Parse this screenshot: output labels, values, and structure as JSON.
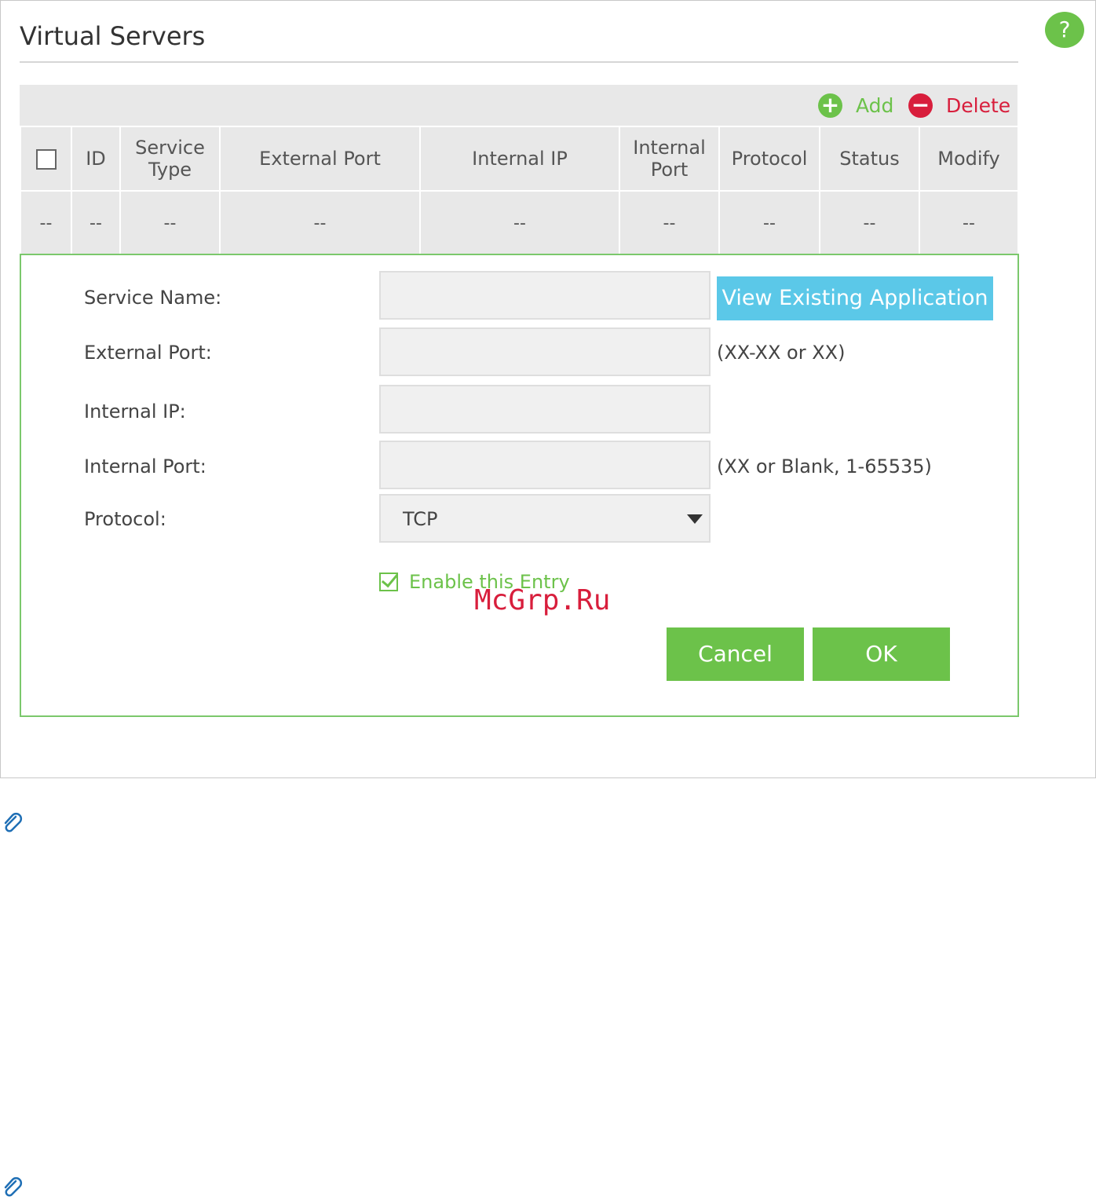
{
  "page": {
    "title": "Virtual Servers",
    "help_label": "?"
  },
  "toolbar": {
    "add_label": "Add",
    "add_icon": "plus-circle-icon",
    "delete_label": "Delete",
    "delete_icon": "minus-circle-icon"
  },
  "table": {
    "headers": [
      "",
      "ID",
      "Service Type",
      "External Port",
      "Internal IP",
      "Internal Port",
      "Protocol",
      "Status",
      "Modify"
    ],
    "rows": [
      [
        "--",
        "--",
        "--",
        "--",
        "--",
        "--",
        "--",
        "--",
        "--"
      ]
    ]
  },
  "form": {
    "service_name_label": "Service Name:",
    "service_name_value": "",
    "view_button_label": "View Existing Application",
    "external_port_label": "External Port:",
    "external_port_value": "",
    "external_port_hint": "(XX-XX or XX)",
    "internal_ip_label": "Internal IP:",
    "internal_ip_value": "",
    "internal_port_label": "Internal Port:",
    "internal_port_value": "",
    "internal_port_hint": "(XX or Blank, 1-65535)",
    "protocol_label": "Protocol:",
    "protocol_value": "TCP",
    "enable_label": "Enable this Entry",
    "enable_checked": true,
    "cancel_label": "Cancel",
    "ok_label": "OK"
  },
  "watermark": "McGrp.Ru",
  "colors": {
    "accent_green": "#6cc24a",
    "delete_red": "#d81e3c",
    "view_button_blue": "#5bc8e8",
    "table_bg": "#e8e8e8"
  }
}
